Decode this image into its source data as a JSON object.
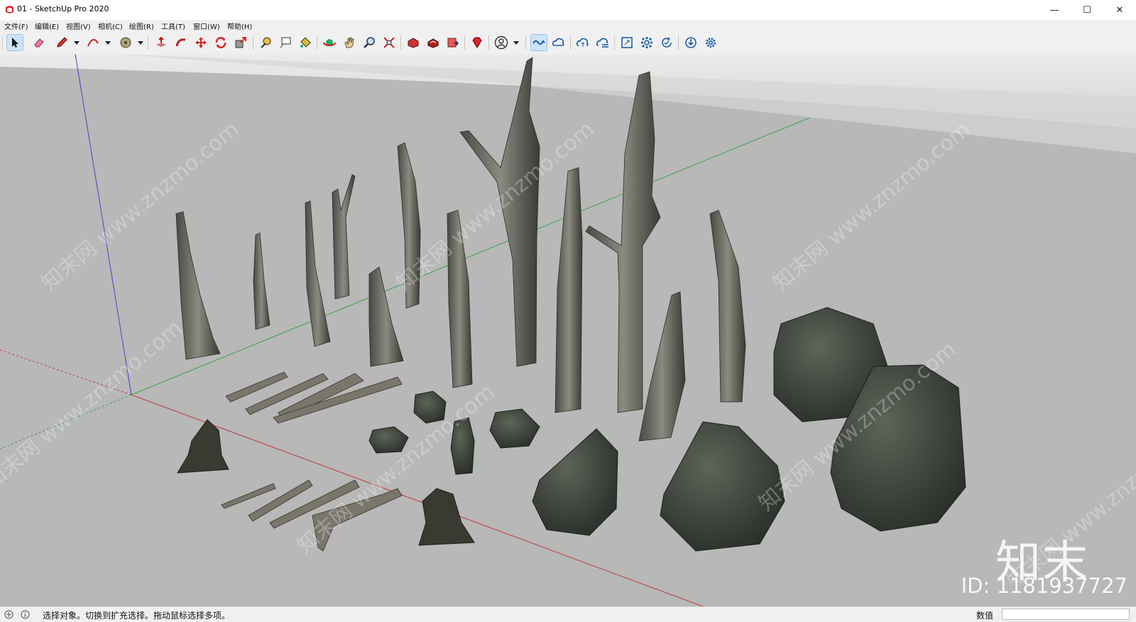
{
  "window": {
    "title": "01 - SketchUp Pro 2020",
    "minimize_glyph": "—",
    "maximize_glyph": "☐",
    "close_glyph": "✕"
  },
  "menu": {
    "items": [
      {
        "label": "文件(F)"
      },
      {
        "label": "编辑(E)"
      },
      {
        "label": "视图(V)"
      },
      {
        "label": "相机(C)"
      },
      {
        "label": "绘图(R)"
      },
      {
        "label": "工具(T)"
      },
      {
        "label": "窗口(W)"
      },
      {
        "label": "帮助(H)"
      }
    ]
  },
  "toolbar": {
    "tools": [
      "select-tool",
      "eraser-tool",
      "pencil-tool",
      "arc-tool",
      "paint-bucket-tool",
      "push-pull-tool",
      "follow-me-tool",
      "move-tool",
      "rotate-tool",
      "scale-tool",
      "tape-measure-tool",
      "text-tool",
      "paint-tool",
      "orbit-tool",
      "pan-tool",
      "zoom-tool",
      "zoom-extents-tool",
      "warehouse-tool",
      "extension-tool",
      "send-tool",
      "ruby-tool",
      "account-tool",
      "styles-tool",
      "cloud-tool-1",
      "cloud-tool-2",
      "cloud-tool-3",
      "section-tool",
      "components-tool",
      "refresh-tool",
      "download-tool",
      "settings-tool"
    ],
    "active_tool": "select-tool"
  },
  "watermark": {
    "brand": "知末",
    "id_text": "ID: 1181937727",
    "diagonal_text": "知末网 www.znzmo.com"
  },
  "status": {
    "text": "选择对象。切换到扩充选择。拖动鼠标选择多项。",
    "measurements_label": "数值",
    "measurements_value": ""
  },
  "colors": {
    "ground": "#b8b8b8",
    "sky": "#d9d9d9",
    "axis_red": "#c43a3a",
    "axis_green": "#3fa24a",
    "axis_blue": "#3b47c8",
    "active_tool_bg": "#cfe3f7"
  }
}
